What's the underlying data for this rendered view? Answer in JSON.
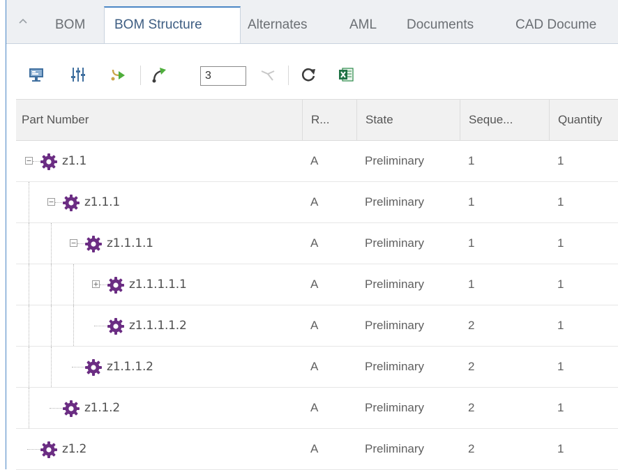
{
  "tabs": [
    {
      "label": "BOM",
      "active": false
    },
    {
      "label": "BOM Structure",
      "active": true
    },
    {
      "label": "Alternates",
      "active": false
    },
    {
      "label": "AML",
      "active": false
    },
    {
      "label": "Documents",
      "active": false
    },
    {
      "label": "CAD Docume",
      "active": false
    }
  ],
  "toolbar": {
    "icons": [
      "monitor-icon",
      "column-settings-icon",
      "expand-arrow-icon",
      "expand-all-icon",
      "collapse-icon",
      "refresh-icon",
      "excel-export-icon"
    ],
    "level_value": "3"
  },
  "grid": {
    "columns": [
      "Part Number",
      "R...",
      "State",
      "Seque...",
      "Quantity"
    ],
    "rows": [
      {
        "part": "z1.1",
        "rev": "A",
        "state": "Preliminary",
        "seq": "1",
        "qty": "1",
        "toggle": "minus"
      },
      {
        "part": "z1.1.1",
        "rev": "A",
        "state": "Preliminary",
        "seq": "1",
        "qty": "1",
        "toggle": "minus"
      },
      {
        "part": "z1.1.1.1",
        "rev": "A",
        "state": "Preliminary",
        "seq": "1",
        "qty": "1",
        "toggle": "minus"
      },
      {
        "part": "z1.1.1.1.1",
        "rev": "A",
        "state": "Preliminary",
        "seq": "1",
        "qty": "1",
        "toggle": "plus"
      },
      {
        "part": "z1.1.1.1.2",
        "rev": "A",
        "state": "Preliminary",
        "seq": "2",
        "qty": "1",
        "toggle": "none"
      },
      {
        "part": "z1.1.1.2",
        "rev": "A",
        "state": "Preliminary",
        "seq": "2",
        "qty": "1",
        "toggle": "none"
      },
      {
        "part": "z1.1.2",
        "rev": "A",
        "state": "Preliminary",
        "seq": "2",
        "qty": "1",
        "toggle": "none"
      },
      {
        "part": "z1.2",
        "rev": "A",
        "state": "Preliminary",
        "seq": "2",
        "qty": "1",
        "toggle": "none"
      }
    ]
  },
  "colors": {
    "accent": "#4a86c5",
    "gear": "#6b2d83",
    "tab_active_text": "#3d5d82"
  }
}
